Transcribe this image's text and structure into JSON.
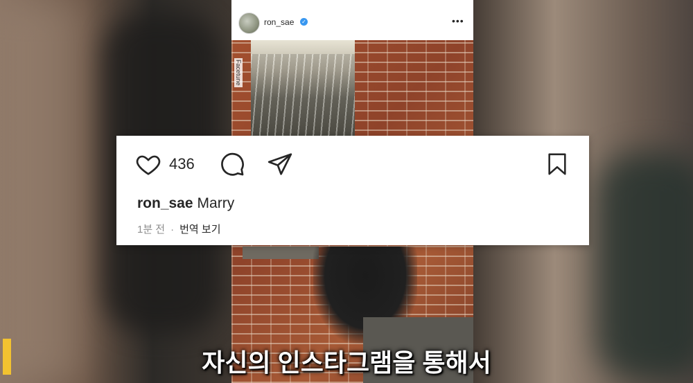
{
  "post": {
    "username": "ron_sae",
    "verified_glyph": "✓",
    "more_glyph": "•••",
    "watermark": "Facetune"
  },
  "card": {
    "likes_count": "436",
    "caption_user": "ron_sae",
    "caption_text": "Marry",
    "time_ago": "1분 전",
    "separator": "·",
    "translate_label": "번역 보기"
  },
  "subtitle": {
    "text": "자신의 인스타그램을 통해서",
    "accent_color": "#f2c230"
  },
  "icons": [
    "heart-icon",
    "comment-icon",
    "share-icon",
    "bookmark-icon",
    "more-icon",
    "verified-icon"
  ]
}
